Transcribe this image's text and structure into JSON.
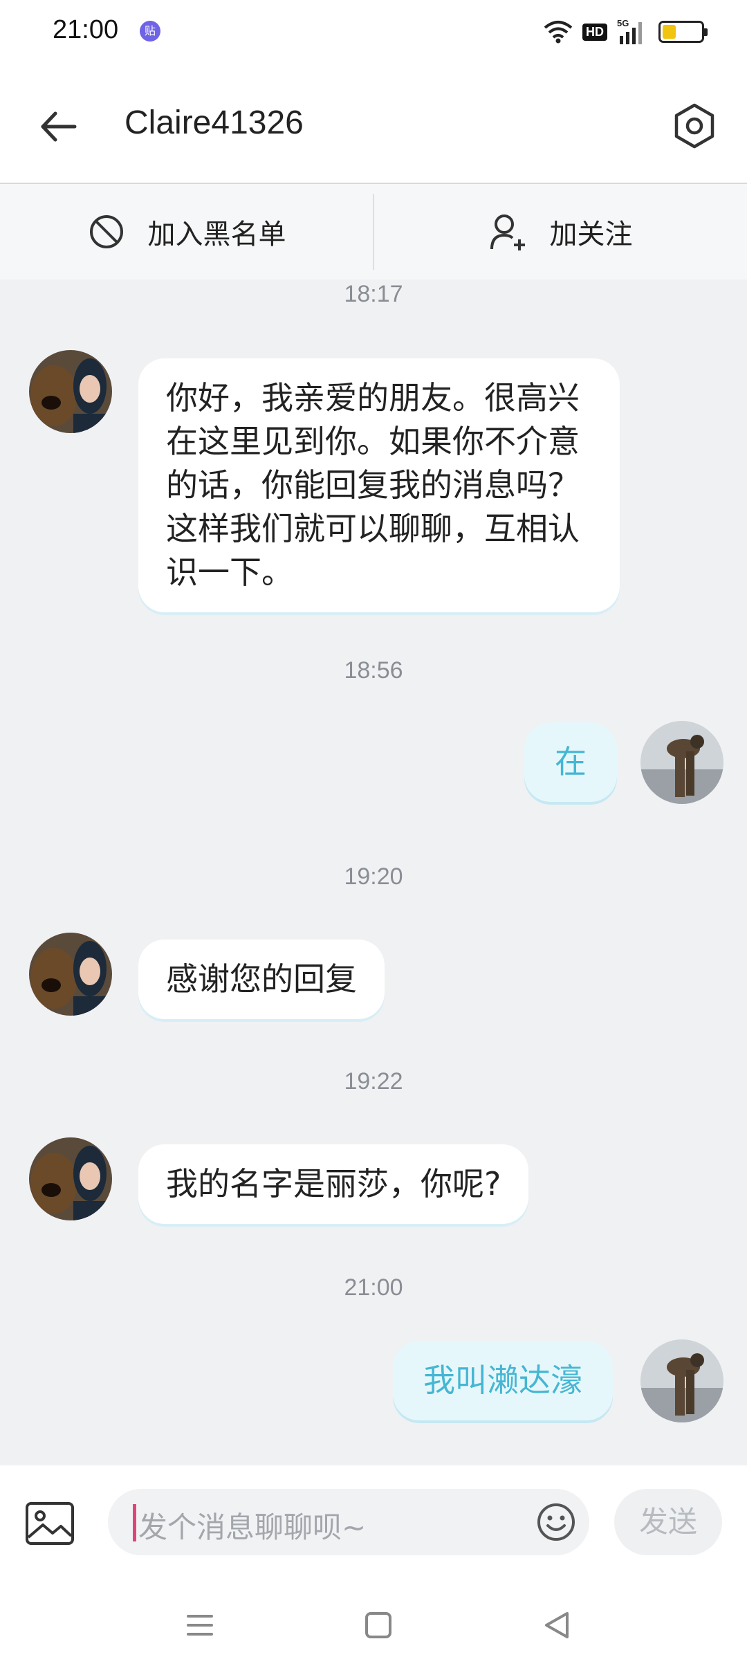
{
  "status_bar": {
    "time": "21:00",
    "notification_icon": "贴",
    "hd_label": "HD",
    "network_label": "5G",
    "battery_level": 0.35,
    "battery_color": "#f1c40f"
  },
  "header": {
    "title": "Claire41326"
  },
  "actions": {
    "block_label": "加入黑名单",
    "follow_label": "加关注"
  },
  "messages": [
    {
      "time": "18:17",
      "direction": "incoming",
      "text": "你好，我亲爱的朋友。很高兴在这里见到你。如果你不介意的话，你能回复我的消息吗？这样我们就可以聊聊，互相认识一下。"
    },
    {
      "time": "18:56",
      "direction": "outgoing",
      "text": "在"
    },
    {
      "time": "19:20",
      "direction": "incoming",
      "text": "感谢您的回复"
    },
    {
      "time": "19:22",
      "direction": "incoming",
      "text": "我的名字是丽莎，你呢?"
    },
    {
      "time": "21:00",
      "direction": "outgoing",
      "text": "我叫濑达濠"
    }
  ],
  "input": {
    "placeholder": "发个消息聊聊呗~",
    "send_label": "发送"
  },
  "colors": {
    "outgoing_text": "#45b6d3",
    "outgoing_bubble": "#e6f7fb",
    "incoming_bubble": "#ffffff",
    "chat_background": "#f0f1f3"
  }
}
